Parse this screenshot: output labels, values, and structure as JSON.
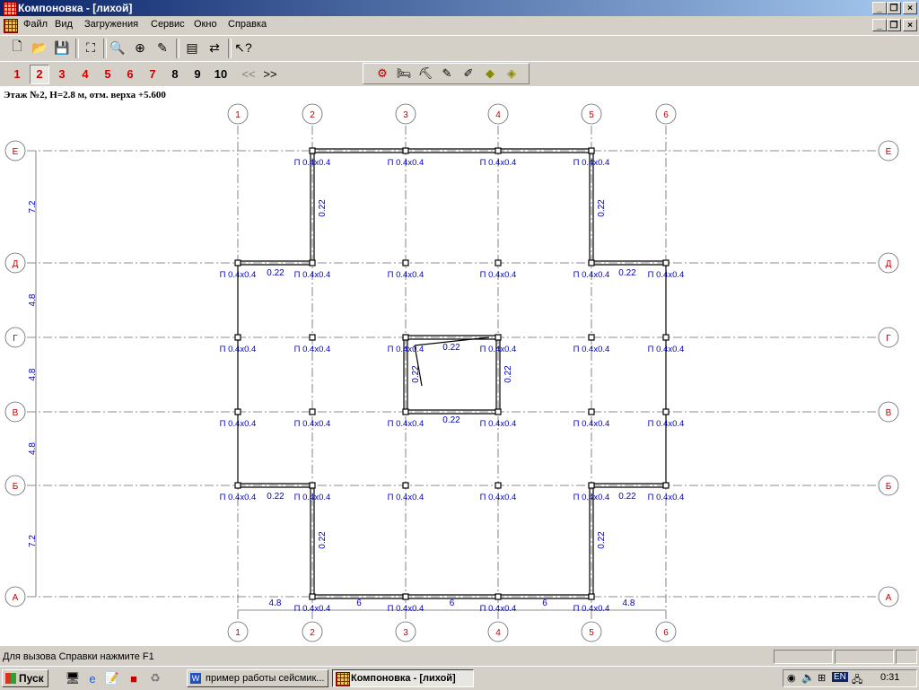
{
  "window": {
    "title": "Компоновка - [лихой]"
  },
  "menu": [
    "Файл",
    "Вид",
    "Загружения",
    "Сервис",
    "Окно",
    "Справка"
  ],
  "floors": {
    "buttons": [
      {
        "label": "1",
        "color": "#d00000"
      },
      {
        "label": "2",
        "color": "#d00000"
      },
      {
        "label": "3",
        "color": "#d00000"
      },
      {
        "label": "4",
        "color": "#d00000"
      },
      {
        "label": "5",
        "color": "#d00000"
      },
      {
        "label": "6",
        "color": "#d00000"
      },
      {
        "label": "7",
        "color": "#d00000"
      },
      {
        "label": "8",
        "color": "#000000"
      },
      {
        "label": "9",
        "color": "#000000"
      },
      {
        "label": "10",
        "color": "#000000"
      }
    ],
    "prev": "<<",
    "next": ">>"
  },
  "drawing": {
    "floor_title": "Этаж №2, Н=2.8 м, отм. верха +5.600",
    "axes_numeric": [
      "1",
      "2",
      "3",
      "4",
      "5",
      "6"
    ],
    "axes_letter": [
      "Е",
      "Д",
      "Г",
      "В",
      "Б",
      "А"
    ],
    "row_spacings": [
      "7.2",
      "4.8",
      "4.8",
      "4.8",
      "7.2"
    ],
    "column_spacings": [
      "4.8",
      "6",
      "6",
      "6",
      "4.8"
    ],
    "column_label": "П 0.4х0.4",
    "wall_thickness": "0.22"
  },
  "status": {
    "help_text": "Для вызова Справки нажмите F1"
  },
  "taskbar": {
    "start": "Пуск",
    "tasks": [
      "пример работы сейсмик...",
      "Компоновка - [лихой]"
    ],
    "tray_lang": "EN",
    "clock": "0:31"
  },
  "colors": {
    "axis_bubble": "#c00000",
    "annotation": "#0000c0",
    "titlebar": "#0a246a"
  }
}
